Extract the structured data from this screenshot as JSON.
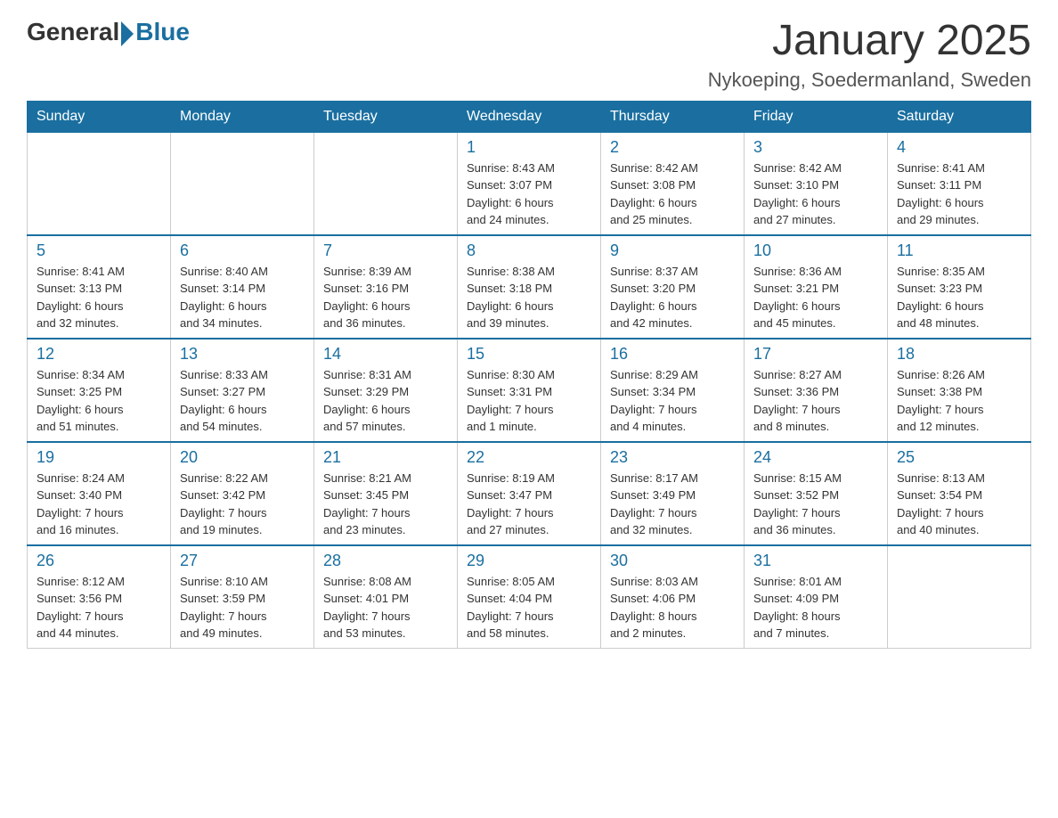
{
  "header": {
    "logo_general": "General",
    "logo_blue": "Blue",
    "month_title": "January 2025",
    "location": "Nykoeping, Soedermanland, Sweden"
  },
  "weekdays": [
    "Sunday",
    "Monday",
    "Tuesday",
    "Wednesday",
    "Thursday",
    "Friday",
    "Saturday"
  ],
  "weeks": [
    [
      {
        "day": "",
        "info": ""
      },
      {
        "day": "",
        "info": ""
      },
      {
        "day": "",
        "info": ""
      },
      {
        "day": "1",
        "info": "Sunrise: 8:43 AM\nSunset: 3:07 PM\nDaylight: 6 hours\nand 24 minutes."
      },
      {
        "day": "2",
        "info": "Sunrise: 8:42 AM\nSunset: 3:08 PM\nDaylight: 6 hours\nand 25 minutes."
      },
      {
        "day": "3",
        "info": "Sunrise: 8:42 AM\nSunset: 3:10 PM\nDaylight: 6 hours\nand 27 minutes."
      },
      {
        "day": "4",
        "info": "Sunrise: 8:41 AM\nSunset: 3:11 PM\nDaylight: 6 hours\nand 29 minutes."
      }
    ],
    [
      {
        "day": "5",
        "info": "Sunrise: 8:41 AM\nSunset: 3:13 PM\nDaylight: 6 hours\nand 32 minutes."
      },
      {
        "day": "6",
        "info": "Sunrise: 8:40 AM\nSunset: 3:14 PM\nDaylight: 6 hours\nand 34 minutes."
      },
      {
        "day": "7",
        "info": "Sunrise: 8:39 AM\nSunset: 3:16 PM\nDaylight: 6 hours\nand 36 minutes."
      },
      {
        "day": "8",
        "info": "Sunrise: 8:38 AM\nSunset: 3:18 PM\nDaylight: 6 hours\nand 39 minutes."
      },
      {
        "day": "9",
        "info": "Sunrise: 8:37 AM\nSunset: 3:20 PM\nDaylight: 6 hours\nand 42 minutes."
      },
      {
        "day": "10",
        "info": "Sunrise: 8:36 AM\nSunset: 3:21 PM\nDaylight: 6 hours\nand 45 minutes."
      },
      {
        "day": "11",
        "info": "Sunrise: 8:35 AM\nSunset: 3:23 PM\nDaylight: 6 hours\nand 48 minutes."
      }
    ],
    [
      {
        "day": "12",
        "info": "Sunrise: 8:34 AM\nSunset: 3:25 PM\nDaylight: 6 hours\nand 51 minutes."
      },
      {
        "day": "13",
        "info": "Sunrise: 8:33 AM\nSunset: 3:27 PM\nDaylight: 6 hours\nand 54 minutes."
      },
      {
        "day": "14",
        "info": "Sunrise: 8:31 AM\nSunset: 3:29 PM\nDaylight: 6 hours\nand 57 minutes."
      },
      {
        "day": "15",
        "info": "Sunrise: 8:30 AM\nSunset: 3:31 PM\nDaylight: 7 hours\nand 1 minute."
      },
      {
        "day": "16",
        "info": "Sunrise: 8:29 AM\nSunset: 3:34 PM\nDaylight: 7 hours\nand 4 minutes."
      },
      {
        "day": "17",
        "info": "Sunrise: 8:27 AM\nSunset: 3:36 PM\nDaylight: 7 hours\nand 8 minutes."
      },
      {
        "day": "18",
        "info": "Sunrise: 8:26 AM\nSunset: 3:38 PM\nDaylight: 7 hours\nand 12 minutes."
      }
    ],
    [
      {
        "day": "19",
        "info": "Sunrise: 8:24 AM\nSunset: 3:40 PM\nDaylight: 7 hours\nand 16 minutes."
      },
      {
        "day": "20",
        "info": "Sunrise: 8:22 AM\nSunset: 3:42 PM\nDaylight: 7 hours\nand 19 minutes."
      },
      {
        "day": "21",
        "info": "Sunrise: 8:21 AM\nSunset: 3:45 PM\nDaylight: 7 hours\nand 23 minutes."
      },
      {
        "day": "22",
        "info": "Sunrise: 8:19 AM\nSunset: 3:47 PM\nDaylight: 7 hours\nand 27 minutes."
      },
      {
        "day": "23",
        "info": "Sunrise: 8:17 AM\nSunset: 3:49 PM\nDaylight: 7 hours\nand 32 minutes."
      },
      {
        "day": "24",
        "info": "Sunrise: 8:15 AM\nSunset: 3:52 PM\nDaylight: 7 hours\nand 36 minutes."
      },
      {
        "day": "25",
        "info": "Sunrise: 8:13 AM\nSunset: 3:54 PM\nDaylight: 7 hours\nand 40 minutes."
      }
    ],
    [
      {
        "day": "26",
        "info": "Sunrise: 8:12 AM\nSunset: 3:56 PM\nDaylight: 7 hours\nand 44 minutes."
      },
      {
        "day": "27",
        "info": "Sunrise: 8:10 AM\nSunset: 3:59 PM\nDaylight: 7 hours\nand 49 minutes."
      },
      {
        "day": "28",
        "info": "Sunrise: 8:08 AM\nSunset: 4:01 PM\nDaylight: 7 hours\nand 53 minutes."
      },
      {
        "day": "29",
        "info": "Sunrise: 8:05 AM\nSunset: 4:04 PM\nDaylight: 7 hours\nand 58 minutes."
      },
      {
        "day": "30",
        "info": "Sunrise: 8:03 AM\nSunset: 4:06 PM\nDaylight: 8 hours\nand 2 minutes."
      },
      {
        "day": "31",
        "info": "Sunrise: 8:01 AM\nSunset: 4:09 PM\nDaylight: 8 hours\nand 7 minutes."
      },
      {
        "day": "",
        "info": ""
      }
    ]
  ]
}
